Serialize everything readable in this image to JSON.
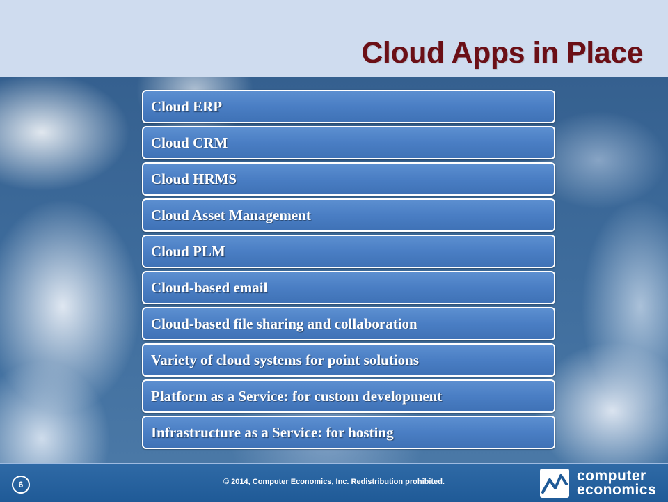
{
  "slide": {
    "title": "Cloud Apps in Place",
    "items": [
      "Cloud ERP",
      "Cloud CRM",
      "Cloud HRMS",
      "Cloud Asset Management",
      "Cloud PLM",
      "Cloud-based email",
      "Cloud-based file sharing and collaboration",
      "Variety of cloud systems for point solutions",
      "Platform as a Service: for custom development",
      "Infrastructure as a Service: for hosting"
    ]
  },
  "footer": {
    "page_number": "6",
    "copyright": "© 2014, Computer Economics, Inc. Redistribution prohibited.",
    "logo_line1": "computer",
    "logo_line2": "economics",
    "logo_icon": "chart-wave-logo-icon"
  },
  "colors": {
    "title": "#6b0f16",
    "header_bg": "#cfdcef",
    "box_fill": "#4a7ec4",
    "footer_bg": "#1f5a97"
  }
}
